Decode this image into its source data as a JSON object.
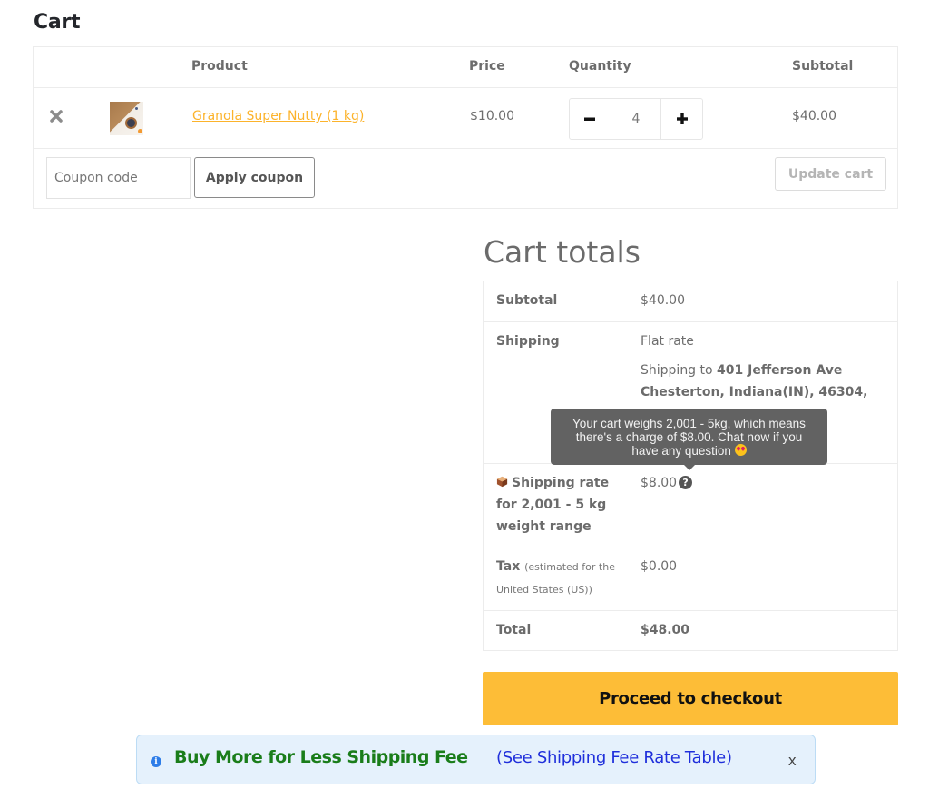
{
  "page": {
    "title": "Cart"
  },
  "cart_table": {
    "headers": {
      "product": "Product",
      "price": "Price",
      "quantity": "Quantity",
      "subtotal": "Subtotal"
    },
    "items": [
      {
        "name": "Granola Super Nutty (1 kg)",
        "price": "$10.00",
        "quantity": "4",
        "subtotal": "$40.00",
        "remove_icon": "close-x-icon",
        "thumbnail": "granola-product-image"
      }
    ],
    "quantity_controls": {
      "decrease": "−",
      "increase": "+"
    },
    "coupon": {
      "placeholder": "Coupon code",
      "value": ""
    },
    "apply_coupon_label": "Apply coupon",
    "update_cart_label": "Update cart"
  },
  "totals": {
    "title": "Cart totals",
    "subtotal_label": "Subtotal",
    "subtotal_value": "$40.00",
    "shipping_label": "Shipping",
    "shipping_method": "Flat rate",
    "shipping_to_prefix": "Shipping to ",
    "shipping_address_line1": "401 Jefferson Ave",
    "shipping_address_line2": "Chesterton, Indiana(IN), 46304,",
    "shipping_rate_label_line1": "Shipping rate",
    "shipping_rate_label_line2": "for 2,001 - 5 kg",
    "shipping_rate_label_line3": "weight range",
    "shipping_rate_icon": "package-box-icon",
    "shipping_rate_value": "$8.00",
    "help_icon": "?",
    "tax_label": "Tax",
    "tax_note_line1": "(estimated for the",
    "tax_note_line2": "United States (US))",
    "tax_value": "$0.00",
    "total_label": "Total",
    "total_value": "$48.00"
  },
  "tooltip": {
    "line1": "Your cart weighs 2,001 - 5kg, which means",
    "line2": "there's a charge of $8.00. Chat now if you",
    "line3": "have any question",
    "emoji": "heart-eyes-emoji"
  },
  "checkout": {
    "label": "Proceed to checkout",
    "color": "#fdbd37"
  },
  "notice": {
    "icon": "i",
    "text": "Buy More for Less Shipping Fee",
    "link": "(See Shipping Fee Rate Table)",
    "close": "x",
    "text_color": "#1a7d1a",
    "link_color": "#1f2fdb"
  }
}
